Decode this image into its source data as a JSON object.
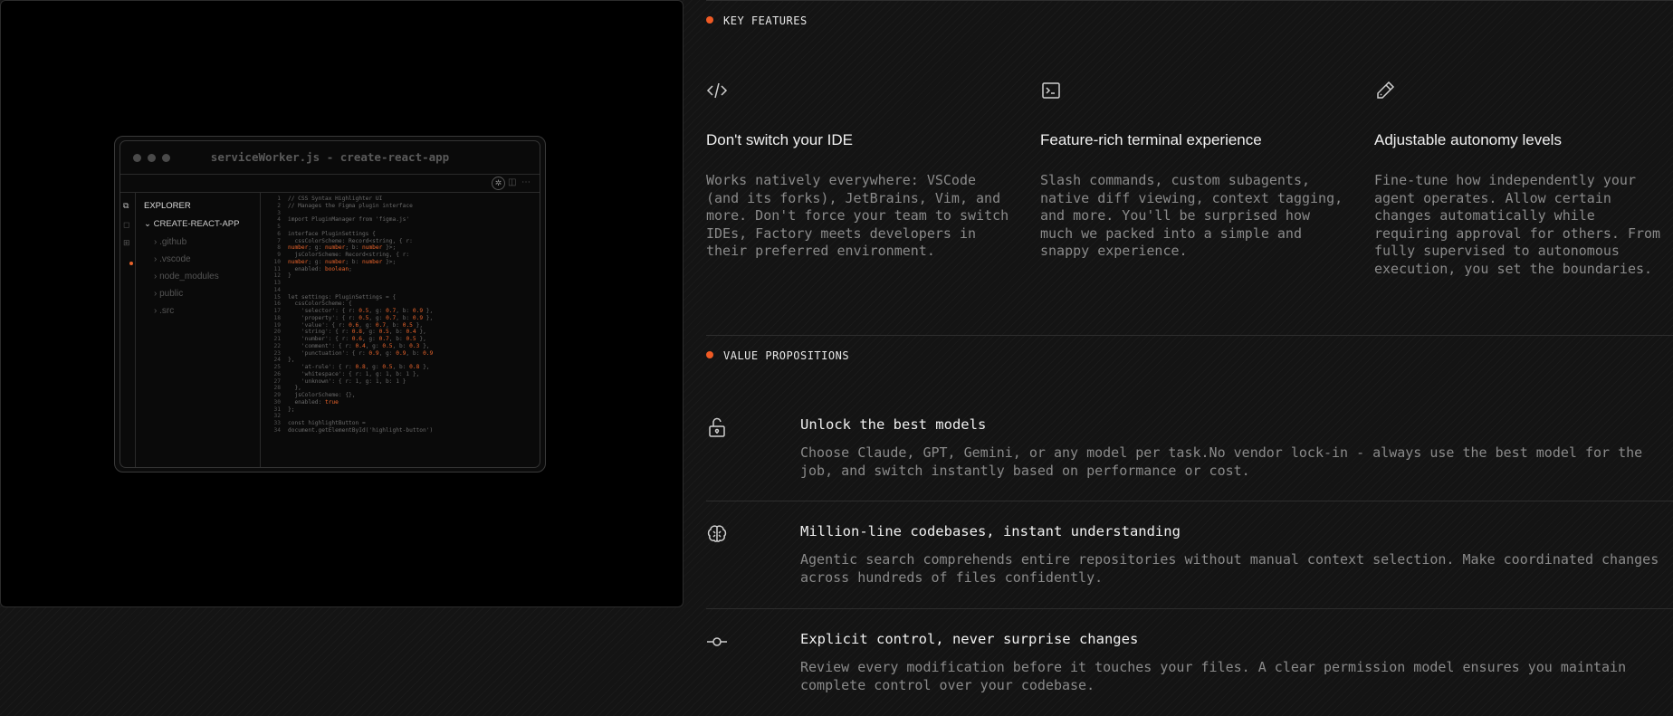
{
  "editor_window": {
    "title": "serviceWorker.js - create-react-app",
    "explorer_title": "EXPLORER",
    "project_root": "CREATE-REACT-APP",
    "folders": [
      ".github",
      ".vscode",
      "node_modules",
      "public",
      ".src"
    ],
    "code_lines": [
      {
        "n": "1",
        "segs": [
          {
            "t": "// CSS Syntax Highlighter UI"
          }
        ]
      },
      {
        "n": "2",
        "segs": [
          {
            "t": "// Manages the Figma plugin interface"
          }
        ]
      },
      {
        "n": "3",
        "segs": [
          {
            "t": ""
          }
        ]
      },
      {
        "n": "4",
        "segs": [
          {
            "t": "import PluginManager from 'figma.js'"
          }
        ]
      },
      {
        "n": "5",
        "segs": [
          {
            "t": ""
          }
        ]
      },
      {
        "n": "6",
        "segs": [
          {
            "t": "interface PluginSettings {"
          }
        ]
      },
      {
        "n": "7",
        "segs": [
          {
            "t": "  cssColorScheme: Record<string, { r:"
          }
        ]
      },
      {
        "n": "8",
        "segs": [
          {
            "t": "number",
            "hl": true
          },
          {
            "t": "; g: "
          },
          {
            "t": "number",
            "hl": true
          },
          {
            "t": "; b: "
          },
          {
            "t": "number",
            "hl": true
          },
          {
            "t": " }>;"
          }
        ]
      },
      {
        "n": "9",
        "segs": [
          {
            "t": "  jsColorScheme: Record<string, { r:"
          }
        ]
      },
      {
        "n": "10",
        "segs": [
          {
            "t": "number",
            "hl": true
          },
          {
            "t": "; g: "
          },
          {
            "t": "number",
            "hl": true
          },
          {
            "t": "; b: "
          },
          {
            "t": "number",
            "hl": true
          },
          {
            "t": " }>;"
          }
        ]
      },
      {
        "n": "11",
        "segs": [
          {
            "t": "  enabled: "
          },
          {
            "t": "boolean",
            "hl": true
          },
          {
            "t": ";"
          }
        ]
      },
      {
        "n": "12",
        "segs": [
          {
            "t": "}"
          }
        ]
      },
      {
        "n": "13",
        "segs": [
          {
            "t": ""
          }
        ]
      },
      {
        "n": "14",
        "segs": [
          {
            "t": ""
          }
        ]
      },
      {
        "n": "15",
        "segs": [
          {
            "t": "let settings: PluginSettings = {"
          }
        ]
      },
      {
        "n": "16",
        "segs": [
          {
            "t": "  cssColorScheme: {"
          }
        ]
      },
      {
        "n": "17",
        "segs": [
          {
            "t": "    'selector': { r: "
          },
          {
            "t": "0.5",
            "hl": true
          },
          {
            "t": ", g: "
          },
          {
            "t": "0.7",
            "hl": true
          },
          {
            "t": ", b: "
          },
          {
            "t": "0.9",
            "hl": true
          },
          {
            "t": " },"
          }
        ]
      },
      {
        "n": "18",
        "segs": [
          {
            "t": "    'property': { r: "
          },
          {
            "t": "0.5",
            "hl": true
          },
          {
            "t": ", g: "
          },
          {
            "t": "0.7",
            "hl": true
          },
          {
            "t": ", b: "
          },
          {
            "t": "0.9",
            "hl": true
          },
          {
            "t": " },"
          }
        ]
      },
      {
        "n": "19",
        "segs": [
          {
            "t": "    'value': { r: "
          },
          {
            "t": "0.6",
            "hl": true
          },
          {
            "t": ", g: "
          },
          {
            "t": "0.7",
            "hl": true
          },
          {
            "t": ", b: "
          },
          {
            "t": "0.5",
            "hl": true
          },
          {
            "t": " },"
          }
        ]
      },
      {
        "n": "20",
        "segs": [
          {
            "t": "    'string': { r: "
          },
          {
            "t": "0.8",
            "hl": true
          },
          {
            "t": ", g: "
          },
          {
            "t": "0.5",
            "hl": true
          },
          {
            "t": ", b: "
          },
          {
            "t": "0.4",
            "hl": true
          },
          {
            "t": " },"
          }
        ]
      },
      {
        "n": "21",
        "segs": [
          {
            "t": "    'number': { r: "
          },
          {
            "t": "0.6",
            "hl": true
          },
          {
            "t": ", g: "
          },
          {
            "t": "0.7",
            "hl": true
          },
          {
            "t": ", b: "
          },
          {
            "t": "0.5",
            "hl": true
          },
          {
            "t": " },"
          }
        ]
      },
      {
        "n": "22",
        "segs": [
          {
            "t": "    'comment': { r: "
          },
          {
            "t": "0.4",
            "hl": true
          },
          {
            "t": ", g: "
          },
          {
            "t": "0.5",
            "hl": true
          },
          {
            "t": ", b: "
          },
          {
            "t": "0.3",
            "hl": true
          },
          {
            "t": " },"
          }
        ]
      },
      {
        "n": "23",
        "segs": [
          {
            "t": "    'punctuation': { r: "
          },
          {
            "t": "0.9",
            "hl": true
          },
          {
            "t": ", g: "
          },
          {
            "t": "0.9",
            "hl": true
          },
          {
            "t": ", b: "
          },
          {
            "t": "0.9",
            "hl": true
          }
        ]
      },
      {
        "n": "24",
        "segs": [
          {
            "t": "},"
          }
        ]
      },
      {
        "n": "25",
        "segs": [
          {
            "t": "    'at-rule': { r: "
          },
          {
            "t": "0.8",
            "hl": true
          },
          {
            "t": ", g: "
          },
          {
            "t": "0.5",
            "hl": true
          },
          {
            "t": ", b: "
          },
          {
            "t": "0.8",
            "hl": true
          },
          {
            "t": " },"
          }
        ]
      },
      {
        "n": "26",
        "segs": [
          {
            "t": "    'whitespace': { r: 1, g: 1, b: 1 },"
          }
        ]
      },
      {
        "n": "27",
        "segs": [
          {
            "t": "    'unknown': { r: 1, g: 1, b: 1 }"
          }
        ]
      },
      {
        "n": "28",
        "segs": [
          {
            "t": "  },"
          }
        ]
      },
      {
        "n": "29",
        "segs": [
          {
            "t": "  jsColorScheme: {},"
          }
        ]
      },
      {
        "n": "30",
        "segs": [
          {
            "t": "  enabled: "
          },
          {
            "t": "true",
            "hl": true
          }
        ]
      },
      {
        "n": "31",
        "segs": [
          {
            "t": "};"
          }
        ]
      },
      {
        "n": "32",
        "segs": [
          {
            "t": ""
          }
        ]
      },
      {
        "n": "33",
        "segs": [
          {
            "t": "const highlightButton ="
          }
        ]
      },
      {
        "n": "34",
        "segs": [
          {
            "t": "document.getElementById('highlight-button')"
          }
        ]
      }
    ]
  },
  "key_features": {
    "heading": "KEY FEATURES",
    "items": [
      {
        "icon": "code-icon",
        "title": "Don't switch your IDE",
        "description": "Works natively everywhere: VSCode (and its forks), JetBrains, Vim, and more. Don't force your team to switch IDEs, Factory meets developers in their preferred environment."
      },
      {
        "icon": "terminal-icon",
        "title": "Feature-rich terminal experience",
        "description": "Slash commands, custom subagents, native diff viewing, context tagging, and more. You'll be surprised how much we packed into a simple and snappy experience."
      },
      {
        "icon": "pencil-icon",
        "title": "Adjustable autonomy levels",
        "description": "Fine-tune how independently your agent operates. Allow certain changes automatically while requiring approval for others. From fully supervised to autonomous execution, you set the boundaries."
      }
    ]
  },
  "value_propositions": {
    "heading": "VALUE PROPOSITIONS",
    "items": [
      {
        "icon": "unlock-icon",
        "title": "Unlock the best models",
        "description": "Choose Claude, GPT, Gemini, or any model per task.No vendor lock-in - always use the best model for the job, and switch instantly based on performance or cost."
      },
      {
        "icon": "brain-icon",
        "title": "Million-line codebases, instant understanding",
        "description": "Agentic search comprehends entire repositories without manual context selection. Make coordinated changes across hundreds of files confidently."
      },
      {
        "icon": "commit-icon",
        "title": "Explicit control, never surprise changes",
        "description": "Review every modification before it touches your files. A clear permission model ensures you maintain complete control over your codebase."
      }
    ]
  },
  "colors": {
    "accent": "#ef5a24",
    "background": "#141414",
    "text_primary": "#f0f0f0",
    "text_secondary": "#8a8a8a"
  }
}
